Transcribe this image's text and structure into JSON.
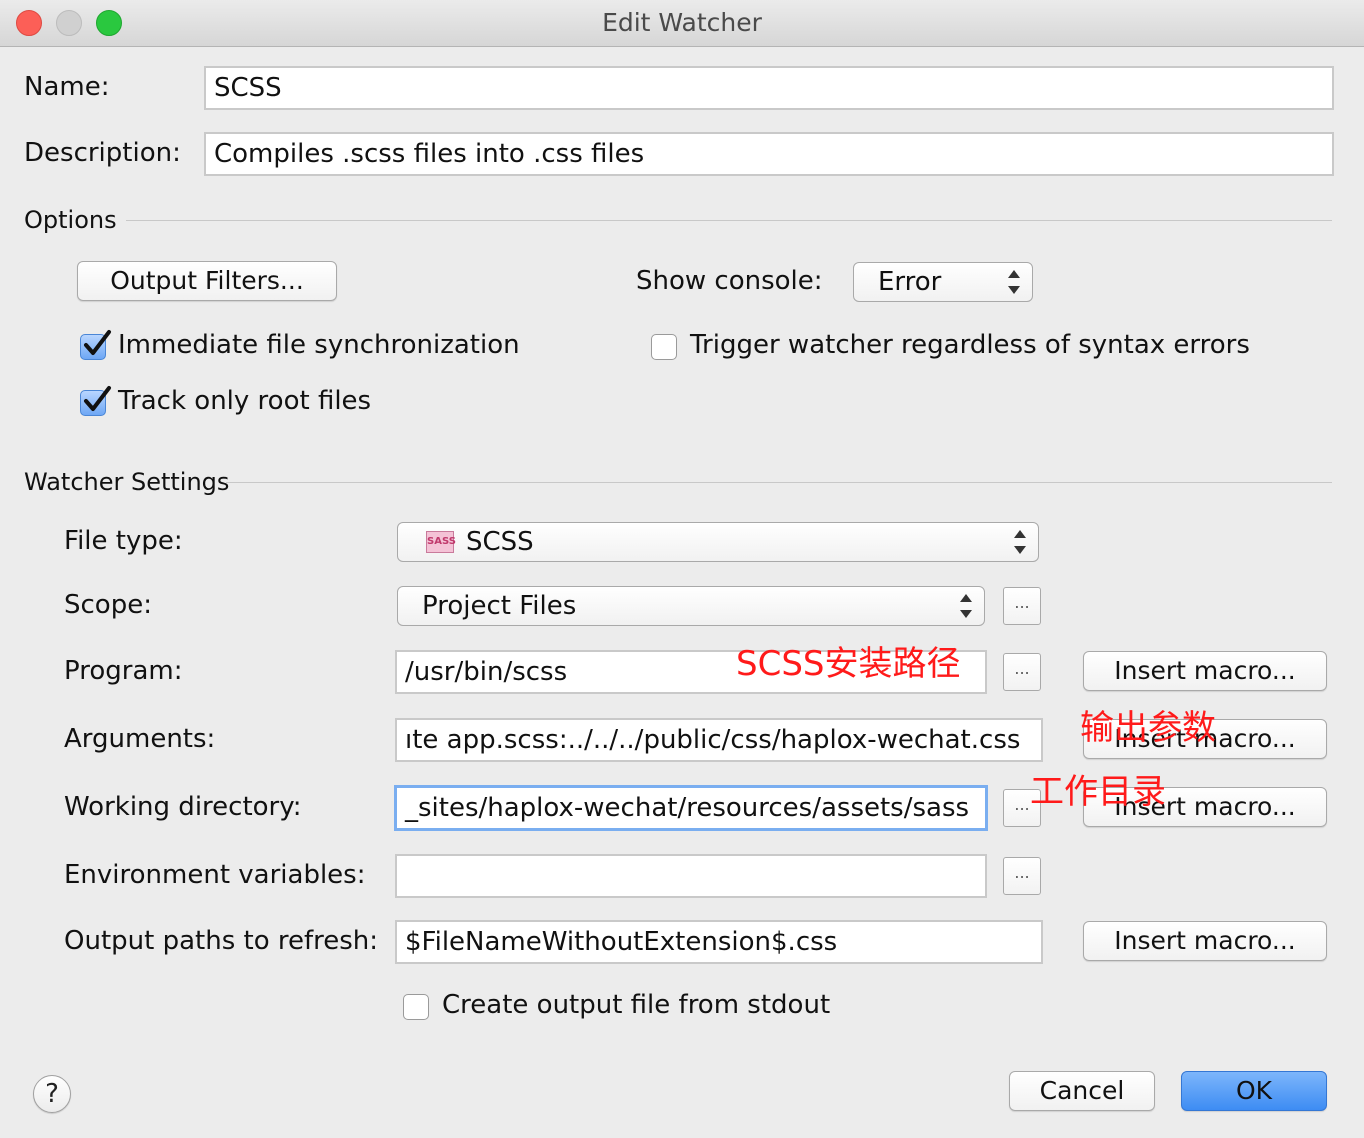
{
  "window": {
    "title": "Edit Watcher",
    "traffic_lights": {
      "close_color": "#fc5f57",
      "minimize_color": "#d0d0d0",
      "zoom_color": "#2ac83f"
    }
  },
  "name": {
    "label": "Name:",
    "value": "SCSS"
  },
  "description": {
    "label": "Description:",
    "value": "Compiles .scss files into .css files"
  },
  "options": {
    "section_label": "Options",
    "output_filters_button": "Output Filters...",
    "show_console_label": "Show console:",
    "show_console_value": "Error",
    "immediate_sync": {
      "label": "Immediate file synchronization",
      "checked": true
    },
    "track_root": {
      "label": "Track only root files",
      "checked": true
    },
    "trigger_regardless": {
      "label": "Trigger watcher regardless of syntax errors",
      "checked": false
    }
  },
  "watcher_settings": {
    "section_label": "Watcher Settings",
    "file_type": {
      "label": "File type:",
      "value": "SCSS",
      "icon": "sass-file-icon",
      "icon_text": "SASS"
    },
    "scope": {
      "label": "Scope:",
      "value": "Project Files",
      "browse": "..."
    },
    "program": {
      "label": "Program:",
      "value": "/usr/bin/scss",
      "browse": "...",
      "macro": "Insert macro..."
    },
    "arguments": {
      "label": "Arguments:",
      "value": "ıte app.scss:../../../public/css/haplox-wechat.css",
      "macro": "Insert macro..."
    },
    "working_directory": {
      "label": "Working directory:",
      "value": "_sites/haplox-wechat/resources/assets/sass",
      "browse": "...",
      "macro": "Insert macro..."
    },
    "environment_variables": {
      "label": "Environment variables:",
      "value": "",
      "browse": "..."
    },
    "output_paths": {
      "label": "Output paths to refresh:",
      "value": "$FileNameWithoutExtension$.css",
      "macro": "Insert macro..."
    },
    "create_output": {
      "label": "Create output file from stdout",
      "checked": false
    }
  },
  "annotations": {
    "program_note": "SCSS安装路径",
    "arguments_note": "输出参数",
    "working_dir_note": "工作目录",
    "color": "#ff1a1a"
  },
  "footer": {
    "help": "?",
    "cancel": "Cancel",
    "ok": "OK"
  }
}
